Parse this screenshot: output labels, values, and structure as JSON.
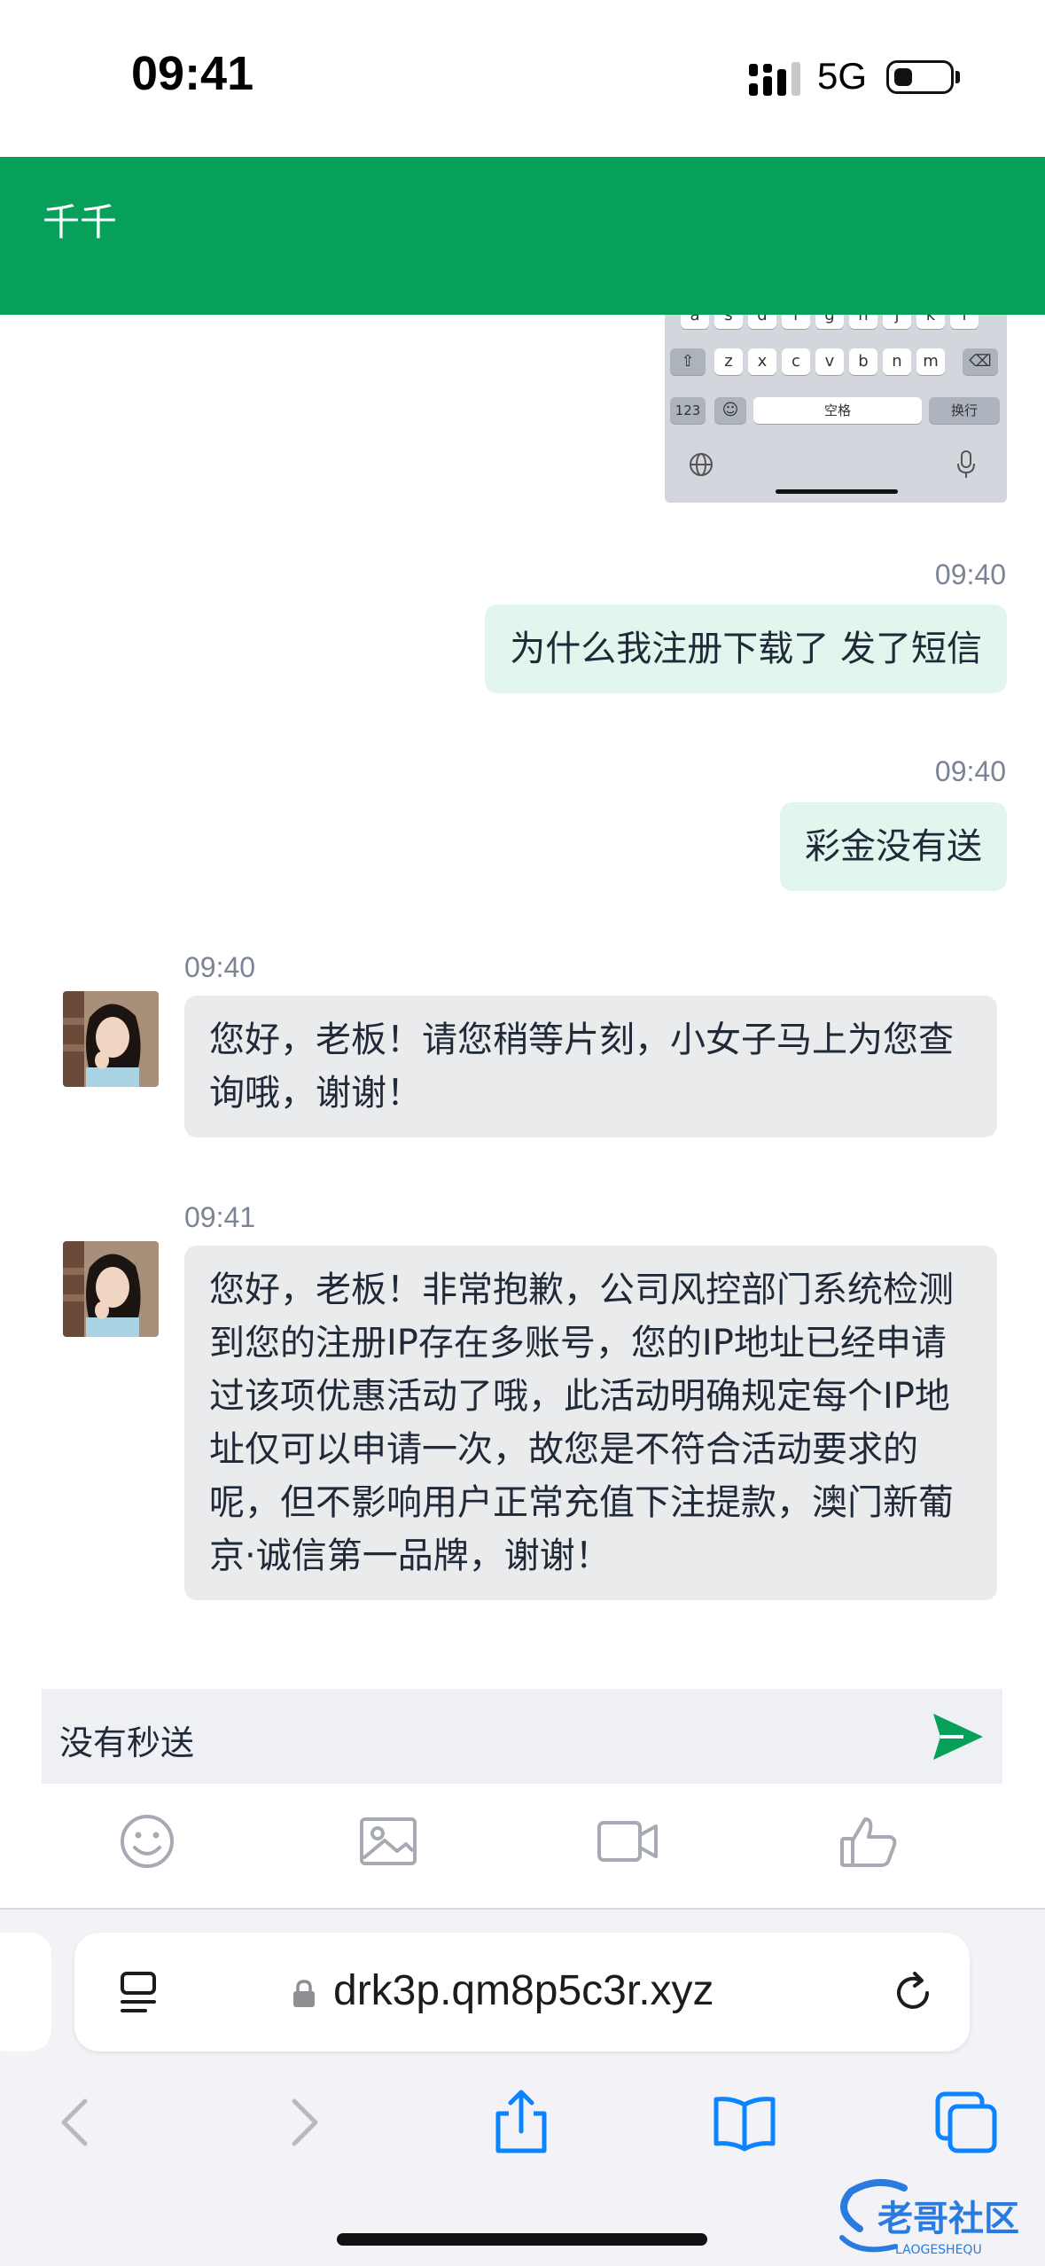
{
  "status_bar": {
    "time": "09:41",
    "network": "5G"
  },
  "header": {
    "title": "千千"
  },
  "keyboard_screenshot": {
    "row2": [
      "z",
      "x",
      "c",
      "v",
      "b",
      "n",
      "m"
    ],
    "num_key": "123",
    "space_key": "空格",
    "return_key": "换行"
  },
  "messages": [
    {
      "direction": "out",
      "time": "09:40",
      "text": "为什么我注册下载了 发了短信"
    },
    {
      "direction": "out",
      "time": "09:40",
      "text": "彩金没有送"
    },
    {
      "direction": "in",
      "time": "09:40",
      "text": "您好，老板！请您稍等片刻，小女子马上为您查询哦，谢谢！"
    },
    {
      "direction": "in",
      "time": "09:41",
      "text": "您好，老板！非常抱歉，公司风控部门系统检测到您的注册IP存在多账号，您的IP地址已经申请过该项优惠活动了哦，此活动明确规定每个IP地址仅可以申请一次，故您是不符合活动要求的呢，但不影响用户正常充值下注提款，澳门新葡京·诚信第一品牌，谢谢！"
    }
  ],
  "composer": {
    "value": "没有秒送"
  },
  "toolbar_icons": [
    "emoji-icon",
    "image-icon",
    "video-icon",
    "thumbs-up-icon"
  ],
  "browser": {
    "url": "drk3p.qm8p5c3r.xyz",
    "accent_color": "#0a84ff"
  },
  "watermark": {
    "text": "老哥社区",
    "subtext": "LAOGESHEQU"
  },
  "colors": {
    "header": "#07a05a",
    "outgoing_bubble": "#e3f6ee",
    "incoming_bubble": "#eaebed",
    "send": "#07a05a"
  }
}
